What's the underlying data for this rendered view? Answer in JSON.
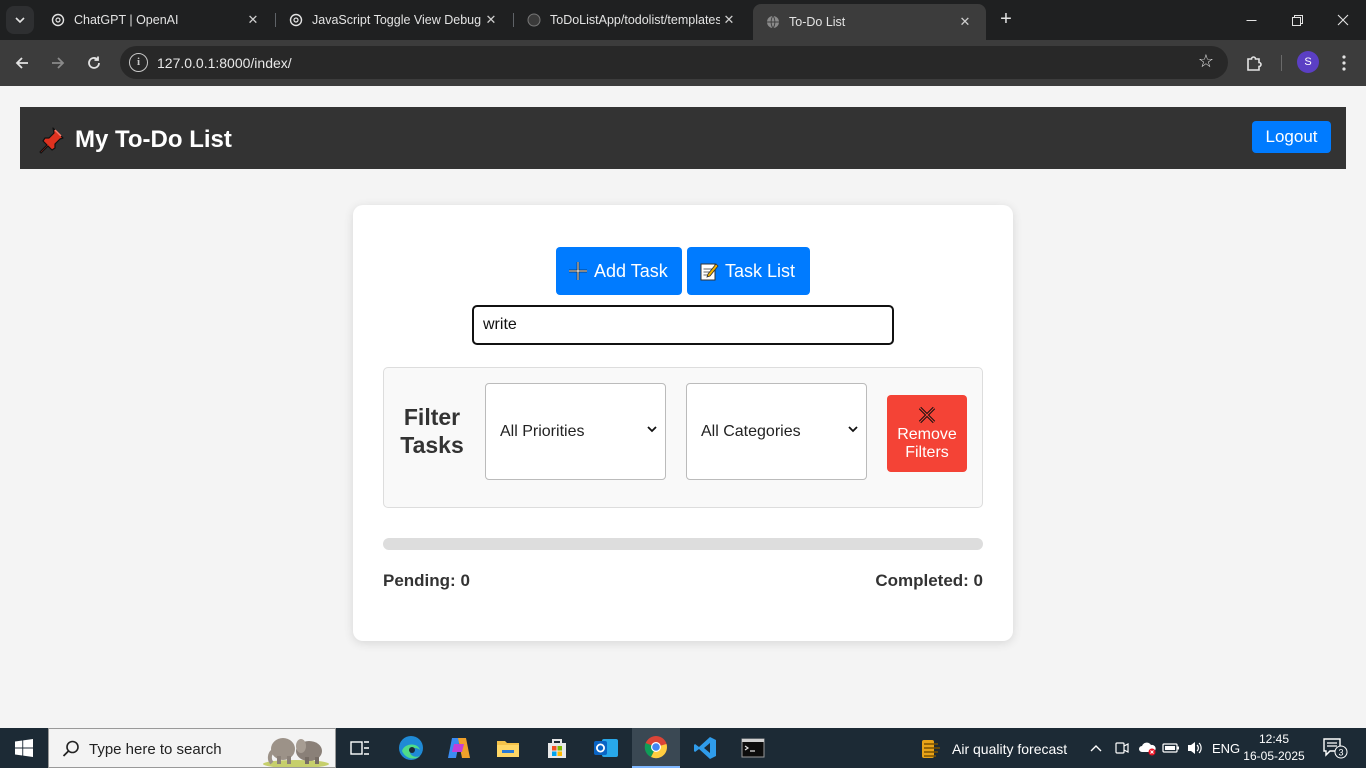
{
  "browser": {
    "tabs": [
      {
        "title": "ChatGPT | OpenAI",
        "active": false
      },
      {
        "title": "JavaScript Toggle View Debug",
        "active": false
      },
      {
        "title": "ToDoListApp/todolist/templates",
        "active": false
      },
      {
        "title": "To-Do List",
        "active": true
      }
    ],
    "new_tab": "+",
    "url": "127.0.0.1:8000/index/",
    "profile_initial": "S"
  },
  "app": {
    "title": "My To-Do List",
    "logout_label": "Logout",
    "add_task_label": "Add Task",
    "task_list_label": "Task List",
    "search_value": "write",
    "filter": {
      "heading_line1": "Filter",
      "heading_line2": "Tasks",
      "priority_selected": "All Priorities",
      "category_selected": "All Categories",
      "remove_label_line1": "Remove",
      "remove_label_line2": "Filters"
    },
    "progress_percent": 0,
    "pending_label": "Pending: 0",
    "completed_label": "Completed: 0"
  },
  "taskbar": {
    "search_placeholder": "Type here to search",
    "weather_text": "Air quality forecast",
    "language": "ENG",
    "time": "12:45",
    "date": "16-05-2025",
    "notification_count": "3"
  },
  "colors": {
    "primary": "#007bff",
    "danger": "#f44336",
    "header_bg": "#333333"
  }
}
